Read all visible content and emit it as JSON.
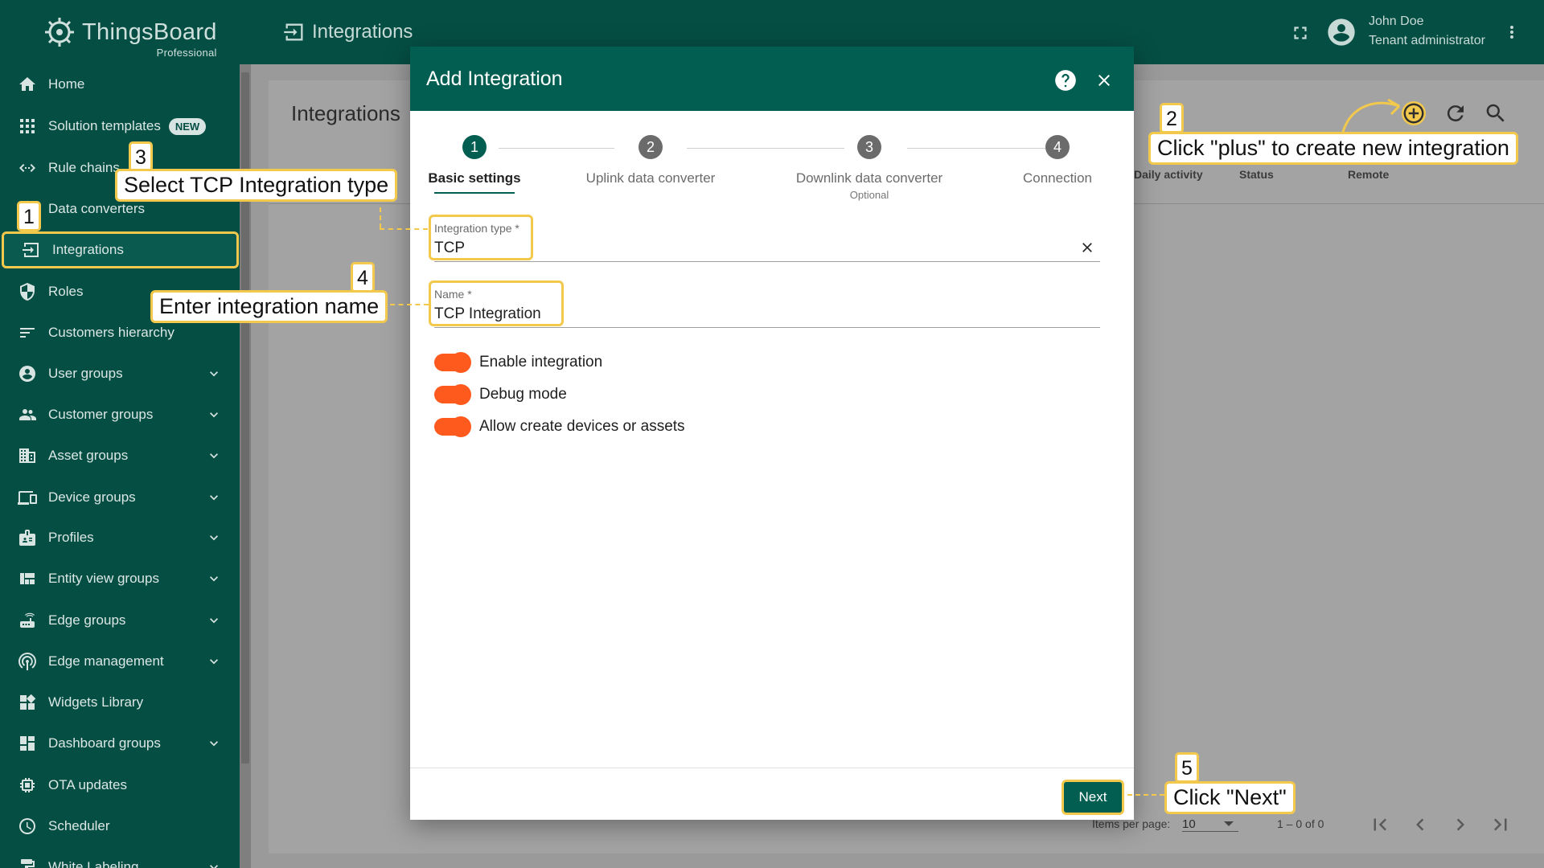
{
  "app": {
    "logo_name": "ThingsBoard",
    "logo_edition": "Professional"
  },
  "topbar": {
    "title": "Integrations",
    "user_name": "John Doe",
    "user_role": "Tenant administrator"
  },
  "sidebar": {
    "new_badge": "NEW",
    "items": [
      {
        "label": "Home",
        "icon": "home-icon"
      },
      {
        "label": "Solution templates",
        "icon": "grid-icon"
      },
      {
        "label": "Rule chains",
        "icon": "code-arrows-icon"
      },
      {
        "label": "Data converters",
        "icon": "converter-icon"
      },
      {
        "label": "Integrations",
        "icon": "input-icon"
      },
      {
        "label": "Roles",
        "icon": "shield-icon"
      },
      {
        "label": "Customers hierarchy",
        "icon": "hierarchy-icon"
      },
      {
        "label": "User groups",
        "icon": "account-icon"
      },
      {
        "label": "Customer groups",
        "icon": "people-icon"
      },
      {
        "label": "Asset groups",
        "icon": "building-icon"
      },
      {
        "label": "Device groups",
        "icon": "devices-icon"
      },
      {
        "label": "Profiles",
        "icon": "badge-icon"
      },
      {
        "label": "Entity view groups",
        "icon": "view-quilt-icon"
      },
      {
        "label": "Edge groups",
        "icon": "router-icon"
      },
      {
        "label": "Edge management",
        "icon": "antenna-icon"
      },
      {
        "label": "Widgets Library",
        "icon": "widgets-icon"
      },
      {
        "label": "Dashboard groups",
        "icon": "dashboard-icon"
      },
      {
        "label": "OTA updates",
        "icon": "chip-icon"
      },
      {
        "label": "Scheduler",
        "icon": "clock-icon"
      },
      {
        "label": "White Labeling",
        "icon": "format-paint-icon"
      }
    ]
  },
  "background": {
    "page_title": "Integrations",
    "columns": [
      "Daily activity",
      "Status",
      "Remote"
    ],
    "items_per_page_label": "Items per page:",
    "items_per_page_value": "10",
    "range_text": "1 – 0 of 0"
  },
  "dialog": {
    "title": "Add Integration",
    "steps": [
      {
        "number": "1",
        "label": "Basic settings",
        "sub": ""
      },
      {
        "number": "2",
        "label": "Uplink data converter",
        "sub": ""
      },
      {
        "number": "3",
        "label": "Downlink data converter",
        "sub": "Optional"
      },
      {
        "number": "4",
        "label": "Connection",
        "sub": ""
      }
    ],
    "integration_type_label": "Integration type *",
    "integration_type_value": "TCP",
    "name_label": "Name *",
    "name_value": "TCP Integration",
    "toggles": [
      {
        "label": "Enable integration",
        "checked": true
      },
      {
        "label": "Debug mode",
        "checked": true
      },
      {
        "label": "Allow create devices or assets",
        "checked": true
      }
    ],
    "next_label": "Next"
  },
  "annotations": [
    {
      "number": "1",
      "text": ""
    },
    {
      "number": "2",
      "text": "Click \"plus\" to create new integration"
    },
    {
      "number": "3",
      "text": "Select TCP Integration type"
    },
    {
      "number": "4",
      "text": "Enter integration name"
    },
    {
      "number": "5",
      "text": "Click \"Next\""
    }
  ],
  "colors": {
    "primary": "#035e52",
    "sidebar": "#054e44",
    "accent_toggle": "#ff5a1e",
    "highlight": "#f2c94c"
  }
}
